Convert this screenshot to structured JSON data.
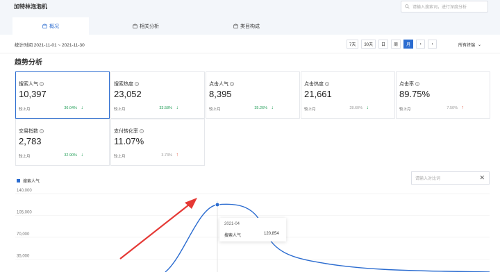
{
  "app_title": "加特林泡泡机",
  "search": {
    "placeholder": "请输入搜索词，进行深度分析"
  },
  "tabs": [
    {
      "label": "概况",
      "active": true
    },
    {
      "label": "相关分析",
      "active": false
    },
    {
      "label": "类目构成",
      "active": false
    }
  ],
  "date_range": "统计时间 2021-11-01 ~ 2021-11-30",
  "period_buttons": [
    "7天",
    "30天",
    "日",
    "周",
    "月"
  ],
  "active_period": "月",
  "terminal_label": "所有终端",
  "section_title": "趋势分析",
  "metrics": [
    {
      "label": "搜索人气",
      "value": "10,397",
      "compare": "较上月",
      "pct": "36.04%",
      "dir": "down"
    },
    {
      "label": "搜索热度",
      "value": "23,052",
      "compare": "较上月",
      "pct": "33.58%",
      "dir": "down"
    },
    {
      "label": "点击人气",
      "value": "8,395",
      "compare": "较上月",
      "pct": "35.26%",
      "dir": "down"
    },
    {
      "label": "点击热度",
      "value": "21,661",
      "compare": "较上月",
      "pct": "28.60%",
      "dir": "down"
    },
    {
      "label": "点击率",
      "value": "89.75%",
      "compare": "较上月",
      "pct": "7.50%",
      "dir": "up"
    },
    {
      "label": "交易指数",
      "value": "2,783",
      "compare": "较上月",
      "pct": "32.90%",
      "dir": "down"
    },
    {
      "label": "支付转化率",
      "value": "11.07%",
      "compare": "较上月",
      "pct": "3.73%",
      "dir": "up"
    }
  ],
  "chart": {
    "legend": "搜索人气",
    "compare_placeholder": "请输入对比词",
    "close_icon": "✕",
    "yticks": [
      "140,000",
      "105,000",
      "70,000",
      "35,000"
    ],
    "tooltip": {
      "date": "2021-04",
      "label": "搜索人气",
      "value": "120,854"
    }
  },
  "chart_data": {
    "type": "line",
    "title": "",
    "ylim": [
      0,
      140000
    ],
    "series": [
      {
        "name": "搜索人气",
        "points": [
          [
            2021.01,
            0
          ],
          [
            2021.15,
            40000
          ],
          [
            2021.25,
            120854
          ],
          [
            2021.4,
            110000
          ],
          [
            2021.5,
            60000
          ],
          [
            2021.6,
            25000
          ],
          [
            2021.75,
            5000
          ],
          [
            2021.9,
            2000
          ]
        ]
      }
    ],
    "highlight": {
      "x": "2021-04",
      "y": 120854
    }
  },
  "colors": {
    "accent": "#2b6cd0",
    "down": "#1f9d55",
    "up": "#e0533b",
    "arrow": "#e53935"
  }
}
